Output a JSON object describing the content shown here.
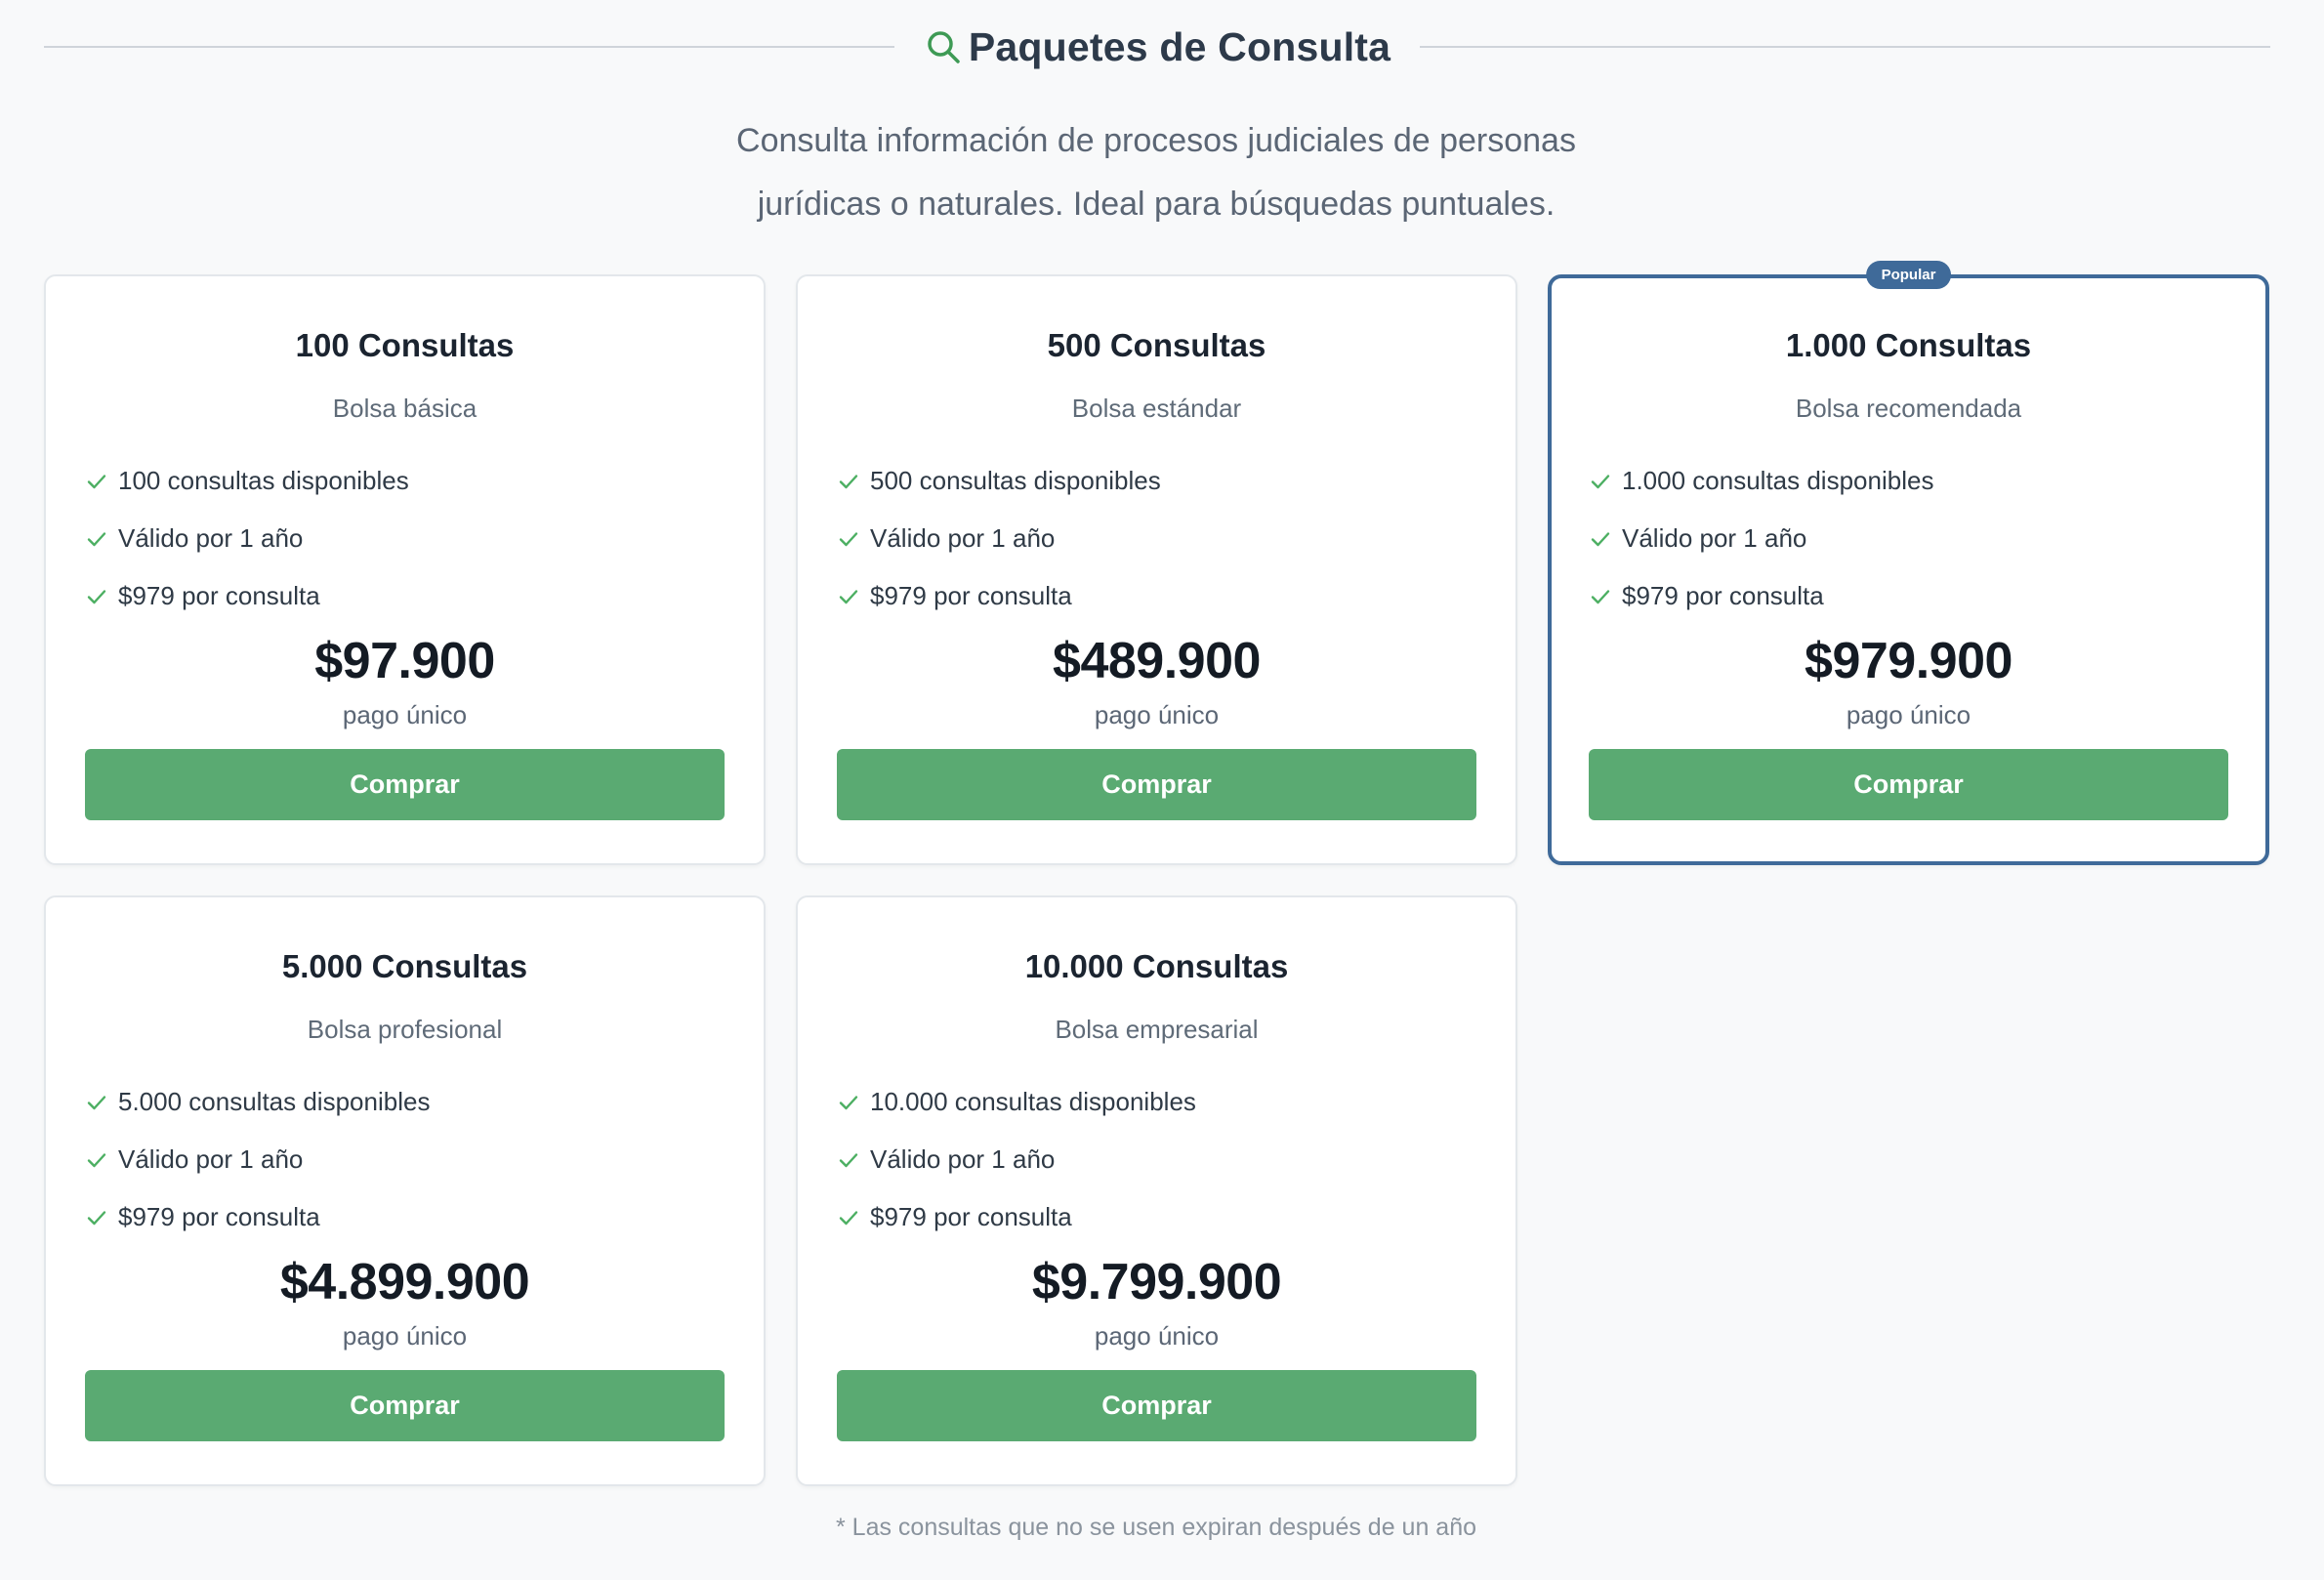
{
  "header": {
    "title": "Paquetes de Consulta",
    "icon": "search-icon",
    "icon_color": "#3e9a55"
  },
  "intro": {
    "line1": "Consulta información de procesos judiciales de personas",
    "line2": "jurídicas o naturales. Ideal para búsquedas puntuales."
  },
  "colors": {
    "accent_green": "#5aaa72",
    "popular_blue": "#3f6a99",
    "check_green": "#4caf62"
  },
  "packages": [
    {
      "title": "100 Consultas",
      "subtitle": "Bolsa básica",
      "features": [
        "100 consultas disponibles",
        "Válido por 1 año",
        "$979 por consulta"
      ],
      "price": "$97.900",
      "price_note": "pago único",
      "button": "Comprar"
    },
    {
      "title": "500 Consultas",
      "subtitle": "Bolsa estándar",
      "features": [
        "500 consultas disponibles",
        "Válido por 1 año",
        "$979 por consulta"
      ],
      "price": "$489.900",
      "price_note": "pago único",
      "button": "Comprar"
    },
    {
      "title": "1.000 Consultas",
      "subtitle": "Bolsa recomendada",
      "badge": "Popular",
      "features": [
        "1.000 consultas disponibles",
        "Válido por 1 año",
        "$979 por consulta"
      ],
      "price": "$979.900",
      "price_note": "pago único",
      "button": "Comprar"
    },
    {
      "title": "5.000 Consultas",
      "subtitle": "Bolsa profesional",
      "features": [
        "5.000 consultas disponibles",
        "Válido por 1 año",
        "$979 por consulta"
      ],
      "price": "$4.899.900",
      "price_note": "pago único",
      "button": "Comprar"
    },
    {
      "title": "10.000 Consultas",
      "subtitle": "Bolsa empresarial",
      "features": [
        "10.000 consultas disponibles",
        "Válido por 1 año",
        "$979 por consulta"
      ],
      "price": "$9.799.900",
      "price_note": "pago único",
      "button": "Comprar"
    }
  ],
  "footnote": "* Las consultas que no se usen expiran después de un año"
}
